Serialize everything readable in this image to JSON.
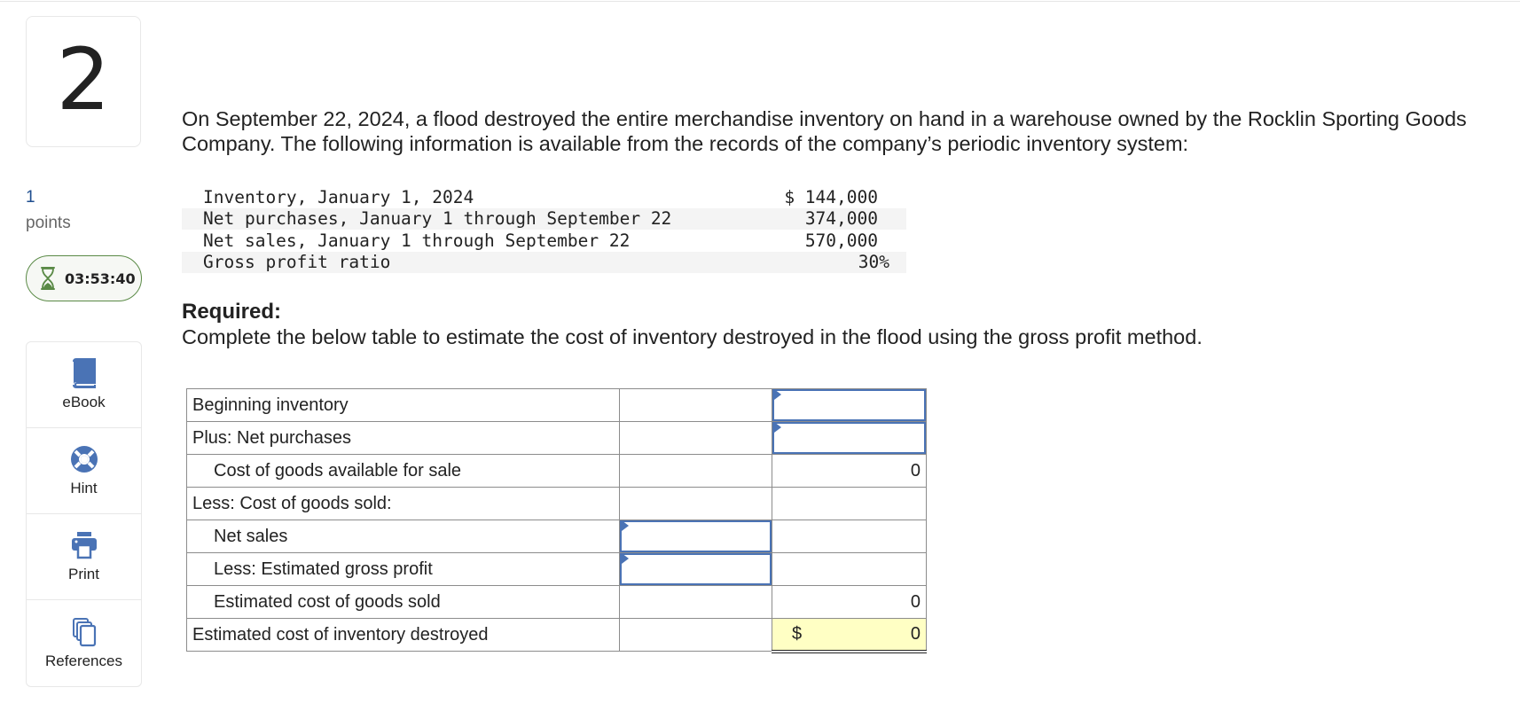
{
  "question": {
    "number": "2",
    "points_value": "1",
    "points_label": "points",
    "timer": "03:53:40"
  },
  "tools": [
    {
      "label": "eBook",
      "icon": "book-icon"
    },
    {
      "label": "Hint",
      "icon": "lifebuoy-icon"
    },
    {
      "label": "Print",
      "icon": "printer-icon"
    },
    {
      "label": "References",
      "icon": "copy-documents-icon"
    }
  ],
  "colors": {
    "accent": "#4a73b5",
    "timer_border": "#5a8a46",
    "total_highlight": "#ffffc4",
    "points_value": "#1f4e8f"
  },
  "intro": "On September 22, 2024, a flood destroyed the entire merchandise inventory on hand in a warehouse owned by the Rocklin Sporting Goods Company. The following information is available from the records of the company’s periodic inventory system:",
  "given": [
    {
      "label": "Inventory, January 1, 2024",
      "value": "$ 144,000"
    },
    {
      "label": "Net purchases, January 1 through September 22",
      "value": "374,000"
    },
    {
      "label": "Net sales, January 1 through September 22",
      "value": "570,000"
    },
    {
      "label": "Gross profit ratio",
      "value": "30%"
    }
  ],
  "required": {
    "title": "Required:",
    "text": "Complete the below table to estimate the cost of inventory destroyed in the flood using the gross profit method."
  },
  "worksheet": {
    "rows": [
      {
        "label": "Beginning inventory",
        "col1": "",
        "col2": ""
      },
      {
        "label": "Plus: Net purchases",
        "col1": "",
        "col2": ""
      },
      {
        "label": "Cost of goods available for sale",
        "col1": "",
        "col2": "0"
      },
      {
        "label": "Less: Cost of goods sold:",
        "col1": "",
        "col2": ""
      },
      {
        "label": "Net sales",
        "col1": "",
        "col2": ""
      },
      {
        "label": "Less: Estimated gross profit",
        "col1": "",
        "col2": ""
      },
      {
        "label": "Estimated cost of goods sold",
        "col1": "",
        "col2": "0"
      },
      {
        "label": "Estimated cost of inventory destroyed",
        "col1": "",
        "col2_currency": "$",
        "col2": "0"
      }
    ]
  }
}
